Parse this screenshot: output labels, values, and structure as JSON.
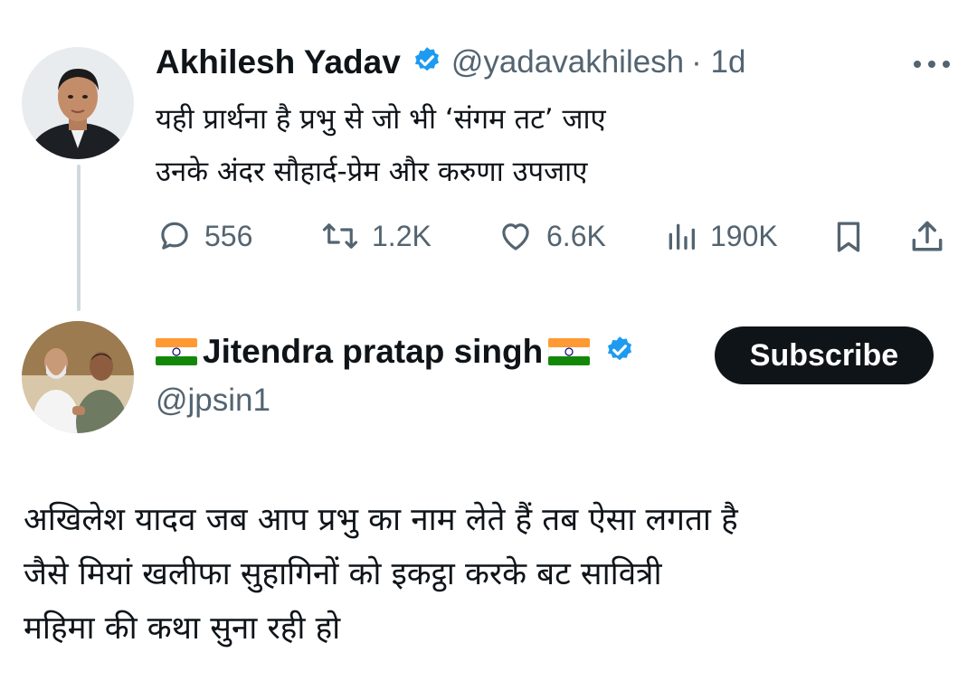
{
  "tweet": {
    "author_name": "Akhilesh Yadav",
    "author_handle": "@yadavakhilesh",
    "time": "· 1d",
    "text_lines": [
      "यही प्रार्थना है प्रभु से जो भी ‘संगम तट’ जाए",
      "उनके अंदर सौहार्द-प्रेम और करुणा उपजाए"
    ],
    "metrics": {
      "replies": "556",
      "reposts": "1.2K",
      "likes": "6.6K",
      "views": "190K"
    }
  },
  "reply": {
    "author_name": "Jitendra pratap singh",
    "author_handle": "@jpsin1",
    "subscribe_label": "Subscribe",
    "text_lines": [
      "अखिलेश यादव जब आप प्रभु का नाम लेते हैं तब ऐसा लगता है",
      "जैसे मियां खलीफा सुहागिनों को इकट्ठा करके बट सावित्री",
      "महिमा की कथा सुना रही हो"
    ]
  },
  "colors": {
    "verified": "#1d9bf0",
    "muted": "#536471",
    "thread_line": "#cfd9de"
  },
  "icons": [
    "more-icon",
    "reply-icon",
    "repost-icon",
    "like-icon",
    "views-icon",
    "bookmark-icon",
    "share-icon",
    "verified-icon",
    "india-flag-icon"
  ]
}
